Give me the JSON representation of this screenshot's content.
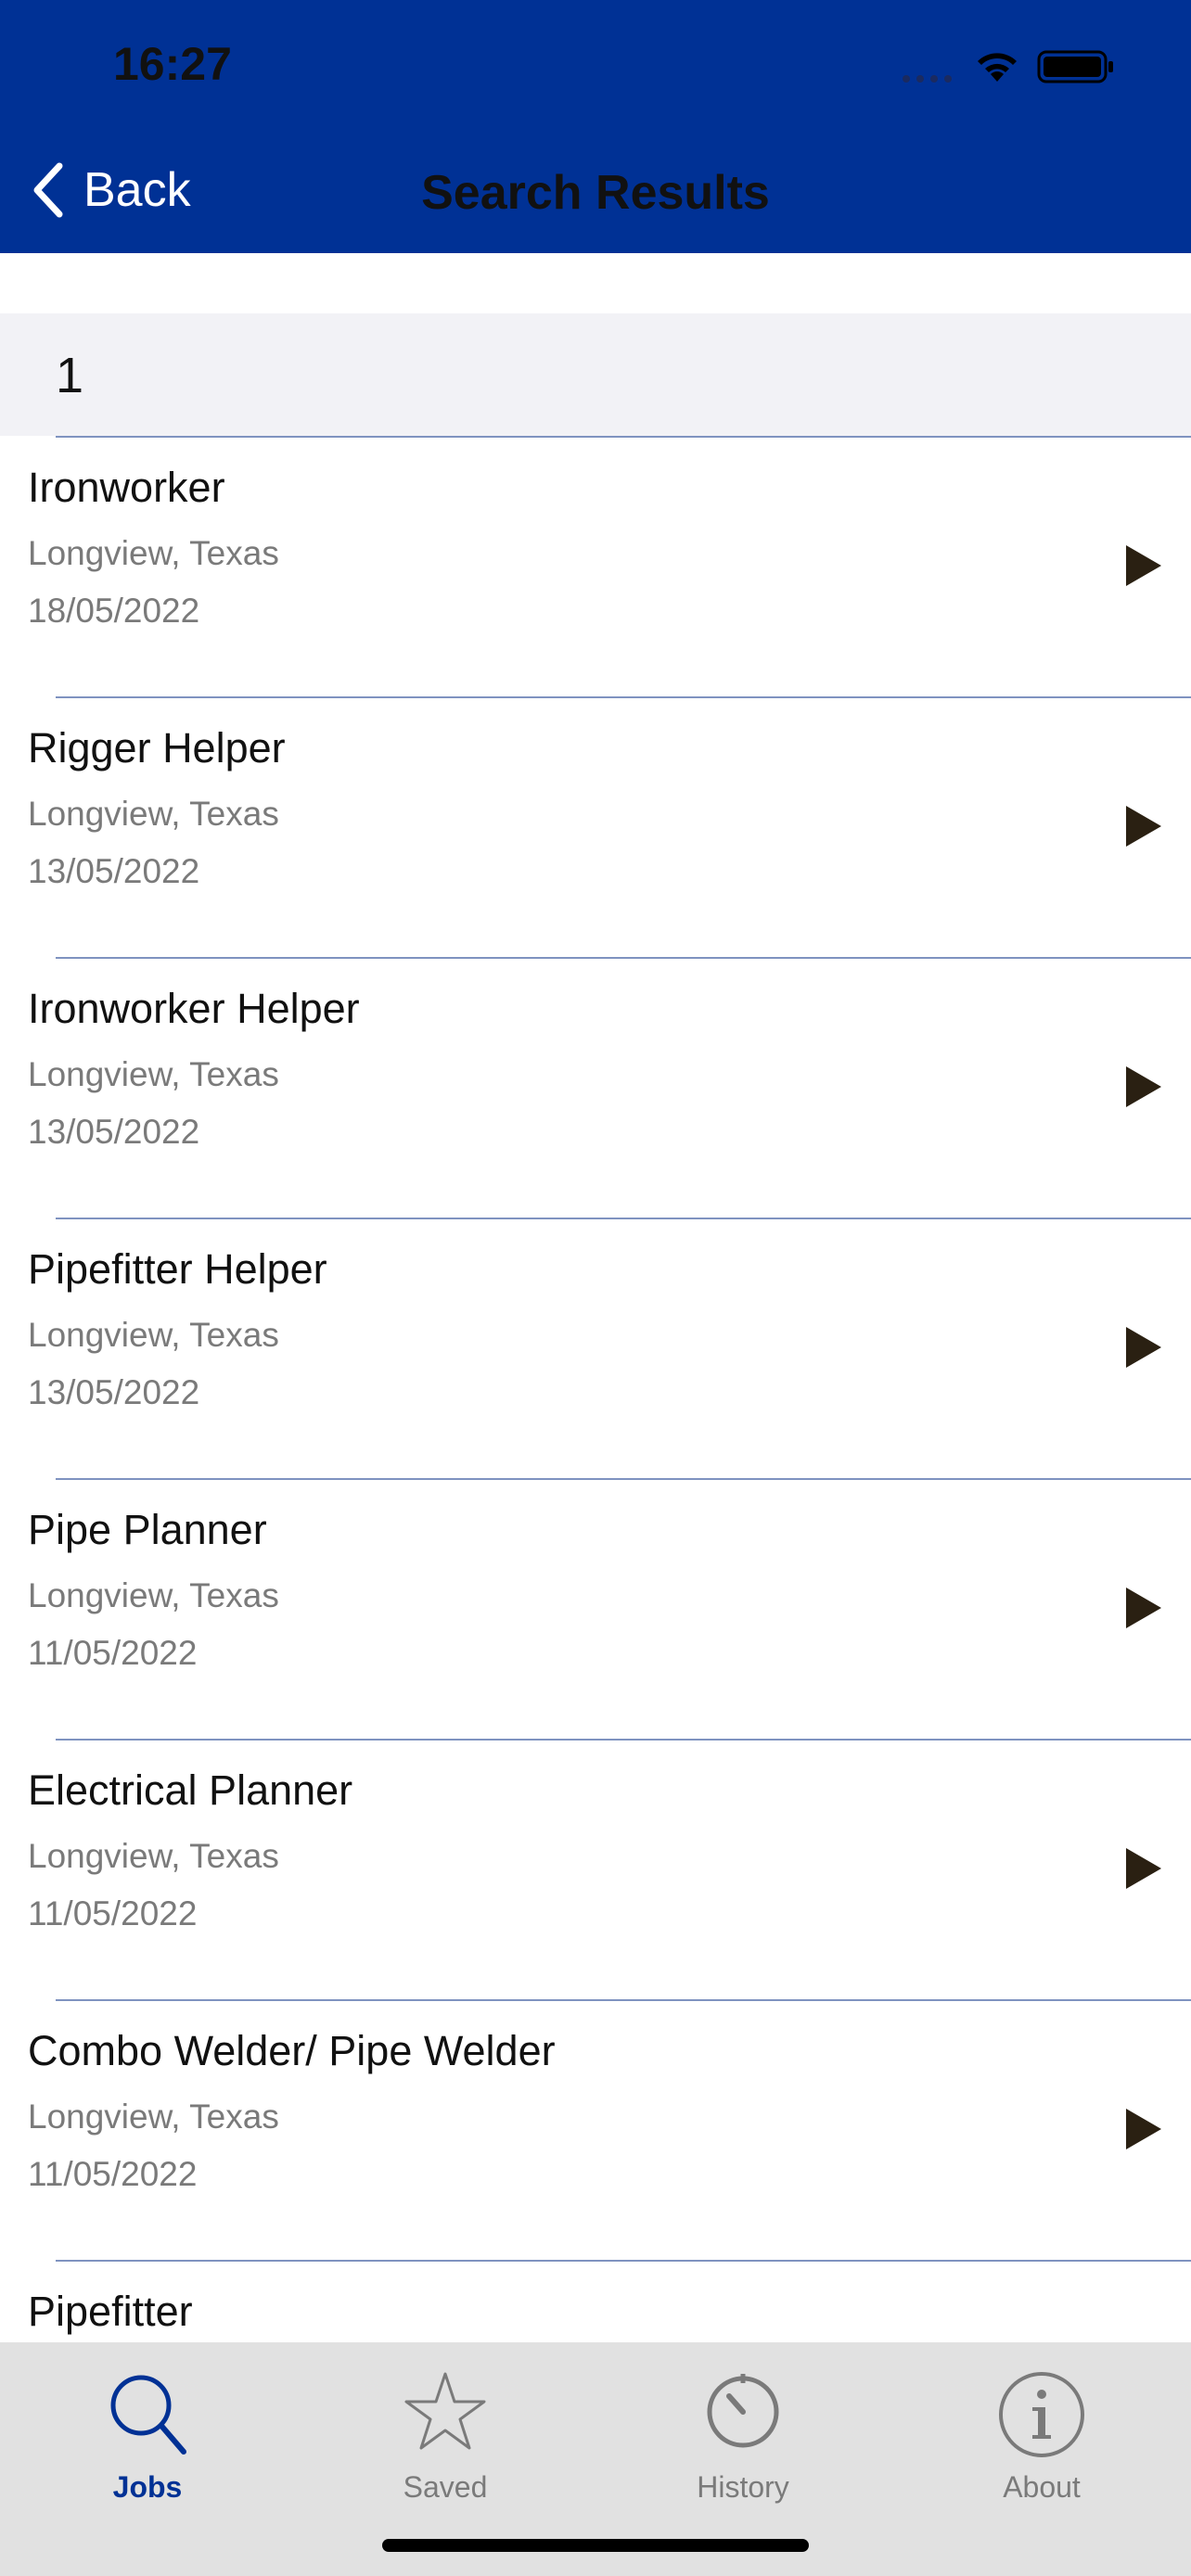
{
  "status_bar": {
    "time": "16:27"
  },
  "nav": {
    "back_label": "Back",
    "title": "Search Results"
  },
  "section": {
    "label": "1"
  },
  "jobs": [
    {
      "title": "Ironworker",
      "location": "Longview, Texas",
      "date": "18/05/2022"
    },
    {
      "title": "Rigger Helper",
      "location": "Longview, Texas",
      "date": "13/05/2022"
    },
    {
      "title": "Ironworker Helper",
      "location": "Longview, Texas",
      "date": "13/05/2022"
    },
    {
      "title": "Pipefitter Helper",
      "location": "Longview, Texas",
      "date": "13/05/2022"
    },
    {
      "title": "Pipe Planner",
      "location": "Longview, Texas",
      "date": "11/05/2022"
    },
    {
      "title": "Electrical Planner",
      "location": "Longview, Texas",
      "date": "11/05/2022"
    },
    {
      "title": "Combo Welder/ Pipe Welder",
      "location": "Longview, Texas",
      "date": "11/05/2022"
    },
    {
      "title": "Pipefitter",
      "location": "",
      "date": ""
    }
  ],
  "tabs": [
    {
      "label": "Jobs",
      "icon": "search-icon",
      "active": true
    },
    {
      "label": "Saved",
      "icon": "star-icon",
      "active": false
    },
    {
      "label": "History",
      "icon": "history-icon",
      "active": false
    },
    {
      "label": "About",
      "icon": "info-icon",
      "active": false
    }
  ],
  "colors": {
    "header_bg": "#003195",
    "accent": "#003195",
    "separator": "#7f93c0",
    "tabbar_bg": "#e1e1e1"
  }
}
